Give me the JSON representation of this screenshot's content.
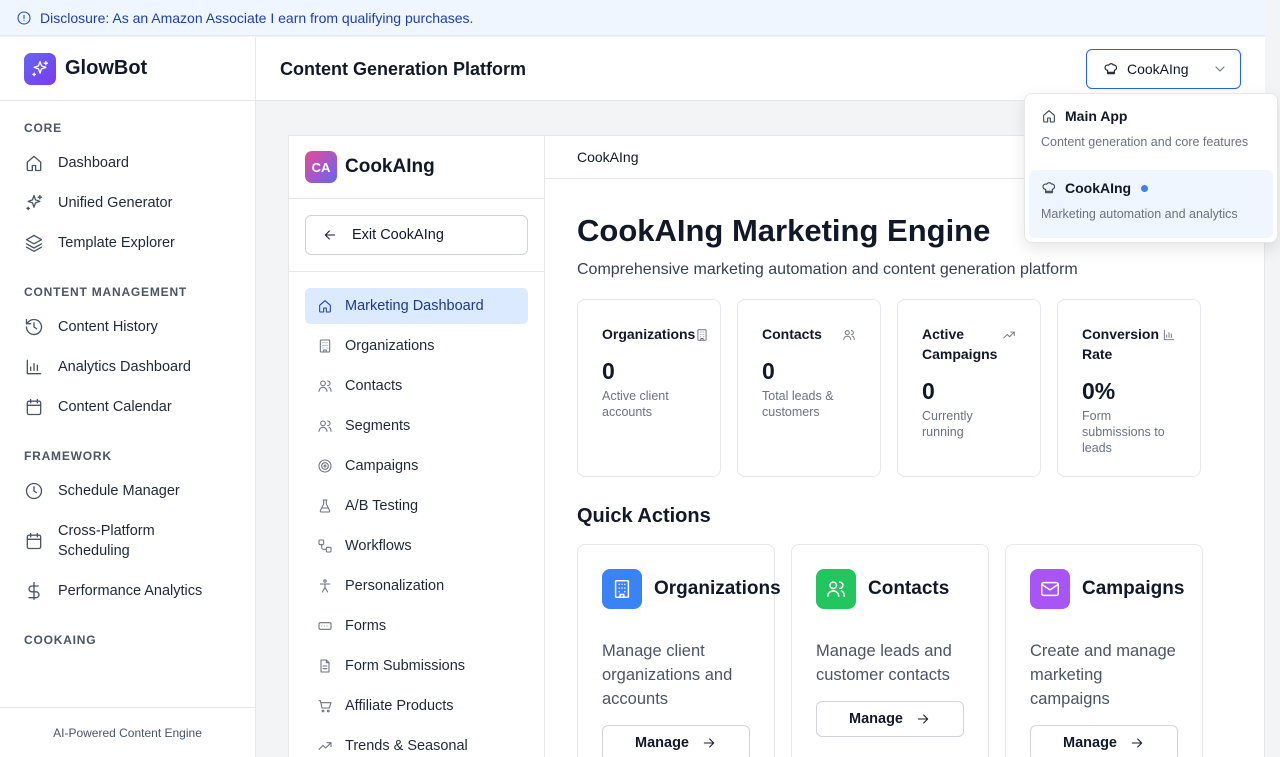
{
  "disclosure": {
    "text": "Disclosure: As an Amazon Associate I earn from qualifying purchases.",
    "icon": "info-icon"
  },
  "brand": {
    "name": "GlowBot",
    "icon": "sparkles-icon"
  },
  "sidebar": {
    "sections": [
      {
        "title": "CORE",
        "items": [
          {
            "label": "Dashboard",
            "icon": "home-icon"
          },
          {
            "label": "Unified Generator",
            "icon": "sparkles-icon"
          },
          {
            "label": "Template Explorer",
            "icon": "layers-icon"
          }
        ]
      },
      {
        "title": "CONTENT MANAGEMENT",
        "items": [
          {
            "label": "Content History",
            "icon": "history-icon"
          },
          {
            "label": "Analytics Dashboard",
            "icon": "bar-chart-icon"
          },
          {
            "label": "Content Calendar",
            "icon": "calendar-icon"
          }
        ]
      },
      {
        "title": "FRAMEWORK",
        "items": [
          {
            "label": "Schedule Manager",
            "icon": "clock-icon"
          },
          {
            "label": "Cross-Platform Scheduling",
            "icon": "calendar-icon"
          },
          {
            "label": "Performance Analytics",
            "icon": "dollar-icon"
          }
        ]
      },
      {
        "title": "COOKAING",
        "items": []
      }
    ],
    "footer": "AI-Powered Content Engine"
  },
  "header": {
    "title": "Content Generation Platform",
    "app_switcher": {
      "selected": "CookAIng",
      "icon": "chef-hat-icon"
    }
  },
  "dropdown": {
    "items": [
      {
        "label": "Main App",
        "description": "Content generation and core features",
        "icon": "home-icon",
        "active": false
      },
      {
        "label": "CookAIng",
        "description": "Marketing automation and analytics",
        "icon": "chef-hat-icon",
        "active": true
      }
    ]
  },
  "subapp": {
    "badge": "CA",
    "name": "CookAIng",
    "exit_label": "Exit CookAIng",
    "nav": [
      {
        "label": "Marketing Dashboard",
        "icon": "home-icon",
        "active": true
      },
      {
        "label": "Organizations",
        "icon": "building-icon"
      },
      {
        "label": "Contacts",
        "icon": "users-icon"
      },
      {
        "label": "Segments",
        "icon": "users-icon"
      },
      {
        "label": "Campaigns",
        "icon": "target-icon"
      },
      {
        "label": "A/B Testing",
        "icon": "flask-icon"
      },
      {
        "label": "Workflows",
        "icon": "workflow-icon"
      },
      {
        "label": "Personalization",
        "icon": "person-icon"
      },
      {
        "label": "Forms",
        "icon": "form-icon"
      },
      {
        "label": "Form Submissions",
        "icon": "file-icon"
      },
      {
        "label": "Affiliate Products",
        "icon": "cart-icon"
      },
      {
        "label": "Trends & Seasonal",
        "icon": "trending-icon"
      }
    ]
  },
  "content": {
    "breadcrumb": "CookAIng",
    "title": "CookAIng Marketing Engine",
    "subtitle": "Comprehensive marketing automation and content generation platform",
    "stats": [
      {
        "title": "Organizations",
        "value": "0",
        "description": "Active client accounts",
        "icon": "building-icon"
      },
      {
        "title": "Contacts",
        "value": "0",
        "description": "Total leads & customers",
        "icon": "users-icon"
      },
      {
        "title": "Active Campaigns",
        "value": "0",
        "description": "Currently running",
        "icon": "trending-icon"
      },
      {
        "title": "Conversion Rate",
        "value": "0%",
        "description": "Form submissions to leads",
        "icon": "bar-chart-icon"
      }
    ],
    "quick_actions_title": "Quick Actions",
    "quick_actions": [
      {
        "title": "Organizations",
        "description": "Manage client organizations and accounts",
        "button": "Manage",
        "color": "#3b82f6",
        "icon": "building-icon"
      },
      {
        "title": "Contacts",
        "description": "Manage leads and customer contacts",
        "button": "Manage",
        "color": "#22c55e",
        "icon": "users-icon"
      },
      {
        "title": "Campaigns",
        "description": "Create and manage marketing campaigns",
        "button": "Manage",
        "color": "#a855f7",
        "icon": "mail-icon"
      }
    ]
  }
}
